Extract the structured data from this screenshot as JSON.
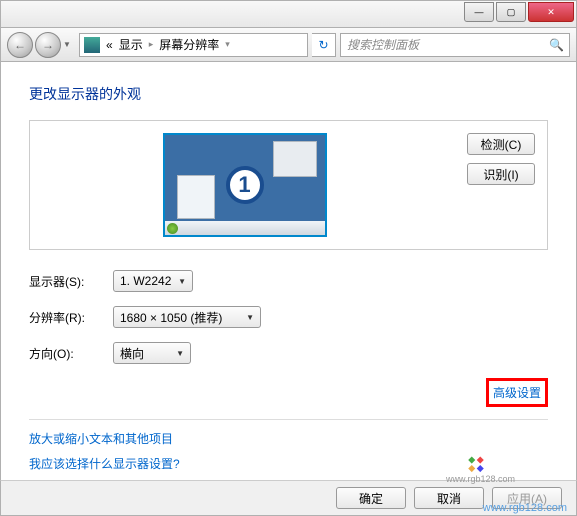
{
  "titlebar": {
    "minimize": "—",
    "maximize": "▢",
    "close": "✕"
  },
  "nav": {
    "back": "←",
    "forward": "→",
    "dropdown": "▼",
    "breadcrumb": {
      "item1": "«",
      "item2": "显示",
      "item3": "屏幕分辨率",
      "sep": "▸"
    },
    "refresh": "↻",
    "search_placeholder": "搜索控制面板",
    "search_icon": "🔍"
  },
  "page": {
    "title": "更改显示器的外观",
    "monitor_number": "1",
    "detect_btn": "检测(C)",
    "identify_btn": "识别(I)",
    "form": {
      "display_label": "显示器(S):",
      "display_value": "1. W2242",
      "resolution_label": "分辨率(R):",
      "resolution_value": "1680 × 1050 (推荐)",
      "orientation_label": "方向(O):",
      "orientation_value": "横向"
    },
    "advanced_link": "高级设置",
    "link1": "放大或缩小文本和其他项目",
    "link2": "我应该选择什么显示器设置?"
  },
  "footer": {
    "ok": "确定",
    "cancel": "取消",
    "apply": "应用(A)"
  },
  "watermark": {
    "url": "www.rgb128.com",
    "small": "www.rgb128.com"
  }
}
